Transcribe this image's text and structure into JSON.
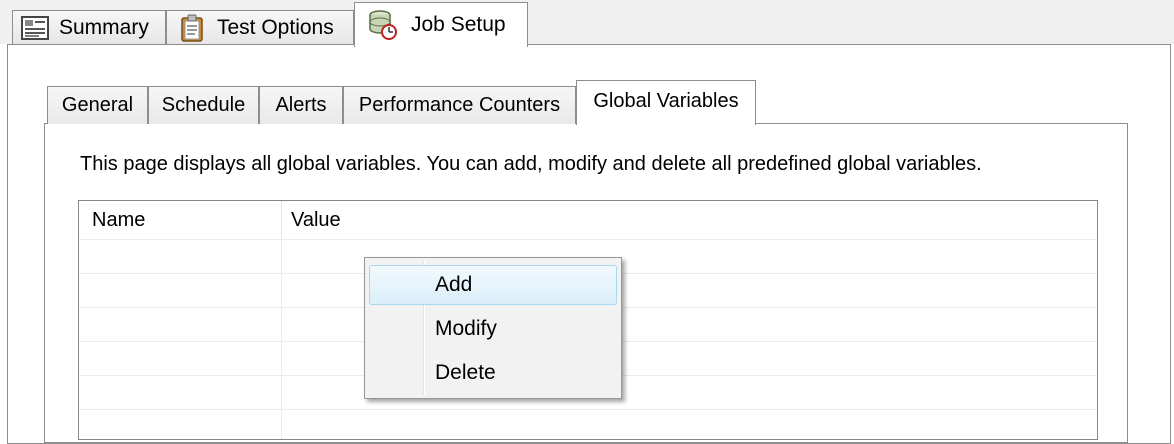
{
  "top_tabs": [
    {
      "label": "Summary",
      "icon": "summary-form-icon",
      "active": false
    },
    {
      "label": "Test Options",
      "icon": "clipboard-icon",
      "active": false
    },
    {
      "label": "Job Setup",
      "icon": "job-setup-icon",
      "active": true
    }
  ],
  "inner_tabs": [
    {
      "label": "General",
      "active": false
    },
    {
      "label": "Schedule",
      "active": false
    },
    {
      "label": "Alerts",
      "active": false
    },
    {
      "label": "Performance Counters",
      "active": false
    },
    {
      "label": "Global Variables",
      "active": true
    }
  ],
  "global_variables": {
    "description": "This page displays all global variables.  You can add, modify and delete all predefined global variables.",
    "columns": [
      "Name",
      "Value"
    ],
    "rows": []
  },
  "context_menu": {
    "items": [
      {
        "label": "Add",
        "highlighted": true
      },
      {
        "label": "Modify",
        "highlighted": false
      },
      {
        "label": "Delete",
        "highlighted": false
      }
    ]
  },
  "colors": {
    "highlight_border": "#a8d8f0",
    "border": "#8d8d8d"
  }
}
